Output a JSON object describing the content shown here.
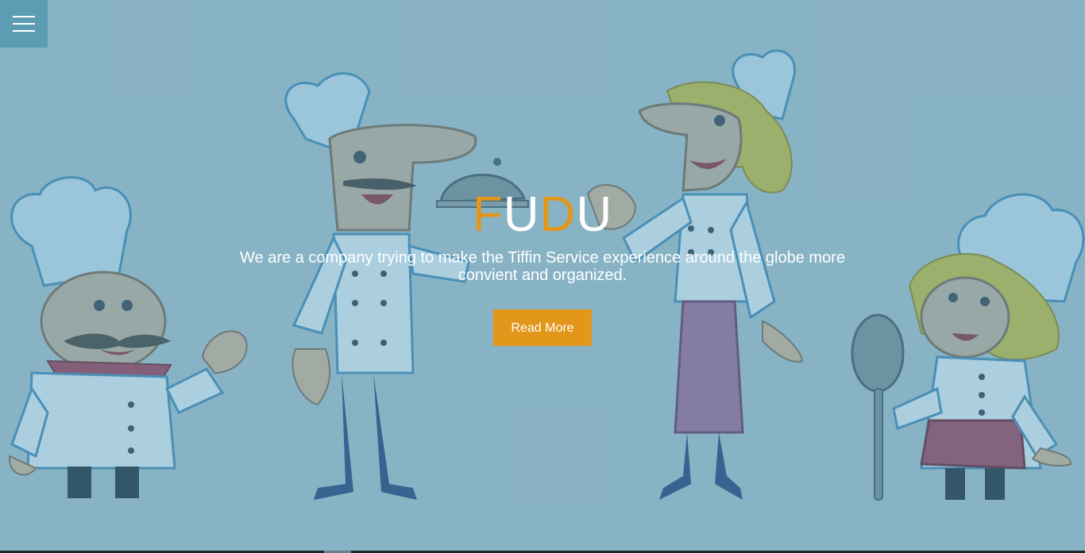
{
  "menu": {
    "icon": "hamburger-menu-icon"
  },
  "hero": {
    "brand_letters": [
      "F",
      "U",
      "D",
      "U"
    ],
    "tagline_line1": "We are a company trying to make the Tiffin Service experience around the globe more",
    "tagline_line2": "convient and organized.",
    "cta_label": "Read More"
  },
  "colors": {
    "background": "#8fb9ca",
    "accent": "#e2961a",
    "menu_bg": "#5d9db3",
    "text": "#ffffff"
  }
}
